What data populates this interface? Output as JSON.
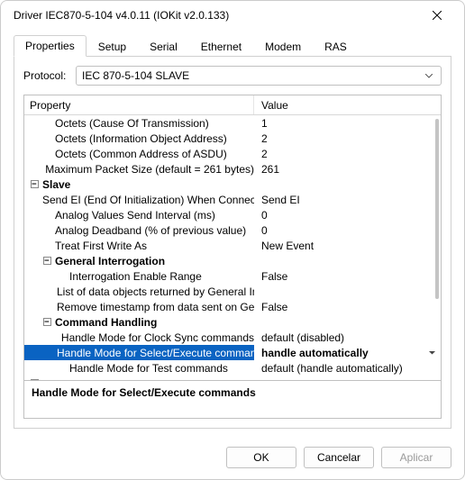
{
  "window": {
    "title": "Driver IEC870-5-104 v4.0.11 (IOKit v2.0.133)"
  },
  "tabs": {
    "items": [
      {
        "label": "Properties",
        "active": true
      },
      {
        "label": "Setup",
        "active": false
      },
      {
        "label": "Serial",
        "active": false
      },
      {
        "label": "Ethernet",
        "active": false
      },
      {
        "label": "Modem",
        "active": false
      },
      {
        "label": "RAS",
        "active": false
      }
    ]
  },
  "protocol": {
    "label": "Protocol:",
    "value": "IEC 870-5-104 SLAVE"
  },
  "grid": {
    "col_prop": "Property",
    "col_val": "Value",
    "rows": [
      {
        "indent": 1,
        "expander": "",
        "label": "Octets (Cause Of Transmission)",
        "value": "1"
      },
      {
        "indent": 1,
        "expander": "",
        "label": "Octets (Information Object Address)",
        "value": "2"
      },
      {
        "indent": 1,
        "expander": "",
        "label": "Octets (Common Address of ASDU)",
        "value": "2"
      },
      {
        "indent": 1,
        "expander": "",
        "label": "Maximum Packet Size (default = 261 bytes)",
        "value": "261"
      },
      {
        "indent": 0,
        "expander": "-",
        "label": "Slave",
        "value": "",
        "group": true
      },
      {
        "indent": 1,
        "expander": "",
        "label": "Send EI (End Of Initialization) When Connected",
        "value": "Send EI"
      },
      {
        "indent": 1,
        "expander": "",
        "label": "Analog Values Send Interval (ms)",
        "value": "0"
      },
      {
        "indent": 1,
        "expander": "",
        "label": "Analog Deadband (% of previous value)",
        "value": "0"
      },
      {
        "indent": 1,
        "expander": "",
        "label": "Treat First Write As",
        "value": "New Event"
      },
      {
        "indent": 1,
        "expander": "-",
        "label": "General Interrogation",
        "value": "",
        "subgroup": true
      },
      {
        "indent": 2,
        "expander": "",
        "label": "Interrogation Enable Range",
        "value": "False"
      },
      {
        "indent": 2,
        "expander": "",
        "label": "List of data objects returned by General Inte...",
        "value": ""
      },
      {
        "indent": 2,
        "expander": "",
        "label": "Remove timestamp from data sent on Gener...",
        "value": "False"
      },
      {
        "indent": 1,
        "expander": "-",
        "label": "Command Handling",
        "value": "",
        "subgroup": true
      },
      {
        "indent": 2,
        "expander": "",
        "label": "Handle Mode for Clock Sync commands",
        "value": "default (disabled)"
      },
      {
        "indent": 2,
        "expander": "",
        "label": "Handle Mode for Select/Execute commands",
        "value": "handle automatically",
        "selected": true,
        "hasDropdown": true
      },
      {
        "indent": 2,
        "expander": "",
        "label": "Handle Mode for Test commands",
        "value": "default (handle automatically)"
      },
      {
        "indent": 0,
        "expander": "+",
        "label": "",
        "value": "",
        "faded": true
      }
    ]
  },
  "description": "Handle Mode for Select/Execute commands",
  "buttons": {
    "ok": "OK",
    "cancel": "Cancelar",
    "apply": "Aplicar"
  }
}
